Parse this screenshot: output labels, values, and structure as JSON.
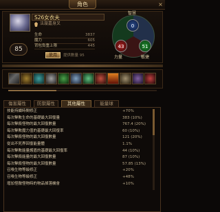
{
  "window": {
    "title": "角色",
    "close_icon": "x-icon"
  },
  "character": {
    "name": "S26女衣夫",
    "rank": "法璇嘉身叉",
    "level": "85",
    "stats": [
      {
        "label": "生命",
        "value": "3837"
      },
      {
        "label": "魔力",
        "value": "605"
      },
      {
        "label": "背包負重上限",
        "value": "445"
      }
    ],
    "use_button": "使用",
    "hint": "提供數量 95"
  },
  "attributes": {
    "top_label": "智慧",
    "top_value": "0",
    "left_label": "力量",
    "left_value": "43",
    "right_label": "敏捷",
    "right_value": "51"
  },
  "skills": [
    "sword-icon",
    "shield-icon",
    "orb-icon",
    "gear-icon",
    "fist-icon",
    "lock-icon",
    "potion-icon",
    "fire-icon",
    "flame-icon",
    "book-icon",
    "wing-icon",
    "grid-icon"
  ],
  "tabs": [
    "傷害屬性",
    "防禦屬性",
    "其他屬性",
    "能量球"
  ],
  "active_tab": "其他屬性",
  "rows": [
    {
      "k": "技能持續時間修正",
      "v": "+70%"
    },
    {
      "k": "每次擊敗生命的基礎最大回復量",
      "v": "383 (10%)"
    },
    {
      "k": "每次擊殺怪物的最大回復數量",
      "v": "767.4 (20%)"
    },
    {
      "k": "每次擊敗魔力值的基礎最大回復率",
      "v": "60 (10%)"
    },
    {
      "k": "每次擊殺怪物的最大回復數量",
      "v": "121 (20%)"
    },
    {
      "k": "從出不死界回復能量體",
      "v": "1.1%"
    },
    {
      "k": "每次擊敗能量護盾的基礎最大回復率",
      "v": "44 (10%)"
    },
    {
      "k": "每次擊殺能量的最大回復數量",
      "v": "87 (10%)"
    },
    {
      "k": "每次擊殺怪物的最大回復數量",
      "v": "57.85 (13%)"
    },
    {
      "k": "召喚生物等級修正",
      "v": "+20%"
    },
    {
      "k": "召喚生物等級修正",
      "v": "+48%"
    },
    {
      "k": "增加怪敵怪物時的物品掉落機會",
      "v": "+10%"
    }
  ],
  "colors": {
    "accent": "#c8a060",
    "health": "#a82020",
    "mana": "#2a4a8a",
    "dex": "#208a30"
  }
}
